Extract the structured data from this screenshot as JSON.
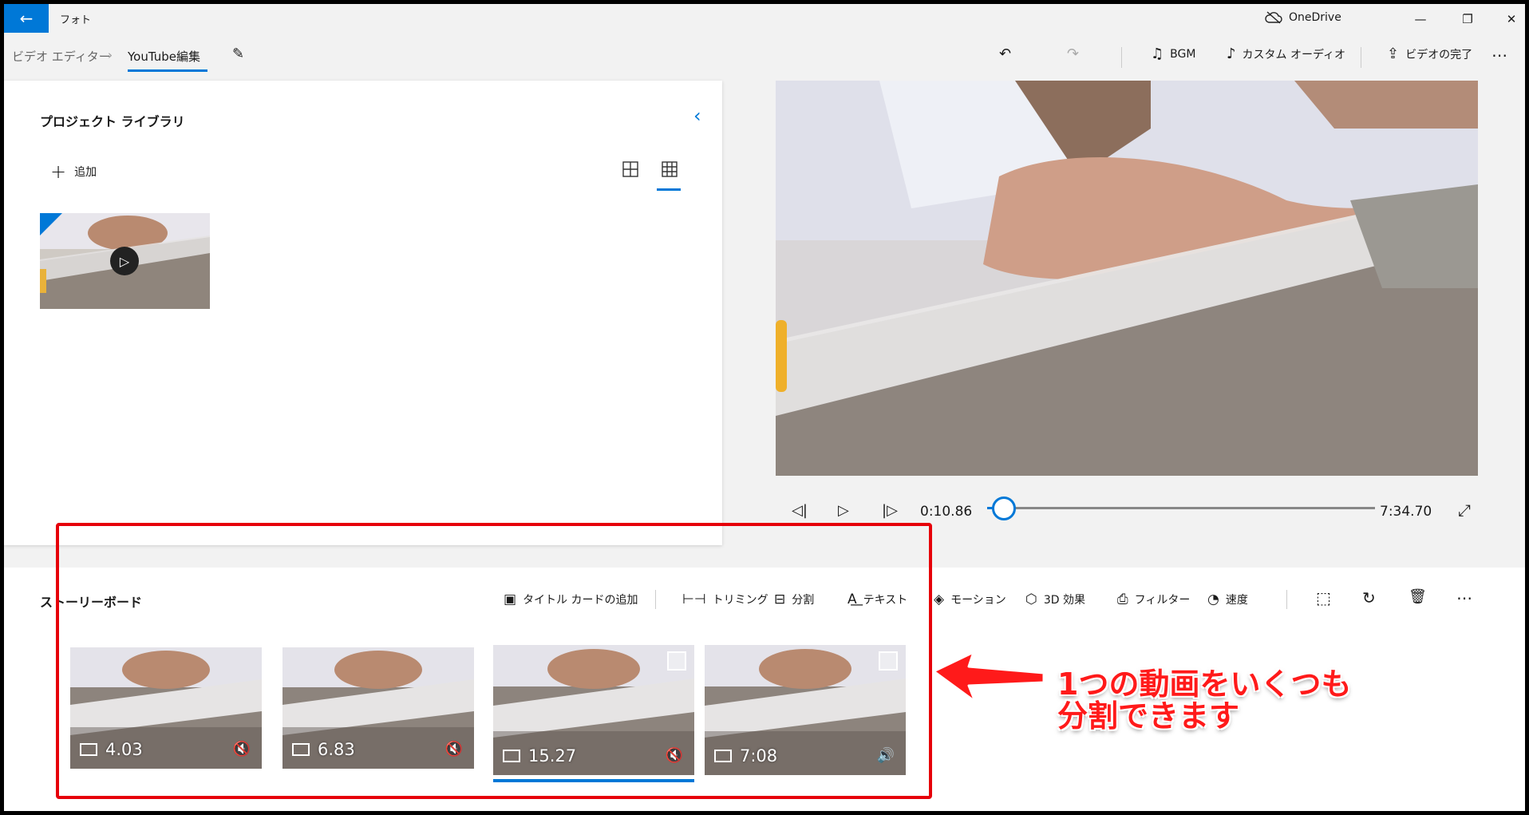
{
  "titlebar": {
    "back_icon": "←",
    "app_title": "フォト",
    "onedrive_label": "OneDrive",
    "minimize_icon": "—",
    "restore_icon": "❐",
    "close_icon": "✕"
  },
  "cmdbar": {
    "breadcrumb_root": "ビデオ エディター",
    "breadcrumb_sep": "›",
    "breadcrumb_current": "YouTube編集",
    "pencil_icon": "✎",
    "undo_icon": "↶",
    "redo_icon": "↷",
    "bgm_icon": "♫",
    "bgm_label": "BGM",
    "custom_audio_icon": "♪",
    "custom_audio_label": "カスタム オーディオ",
    "finish_icon": "⇪",
    "finish_label": "ビデオの完了",
    "more_icon": "⋯"
  },
  "library": {
    "title": "プロジェクト ライブラリ",
    "collapse_icon": "‹",
    "add_icon": "+",
    "add_label": "追加",
    "play_icon": "▷"
  },
  "player": {
    "prev_frame_icon": "◁|",
    "play_icon": "▷",
    "next_frame_icon": "|▷",
    "current_time": "0:10.86",
    "total_time": "7:34.70",
    "fullscreen_icon": "⤢",
    "progress": 0.024
  },
  "storyboard": {
    "title": "ストーリーボード",
    "title_card_icon": "▣",
    "title_card_label": "タイトル カードの追加",
    "trim_icon": "⊢⊣",
    "trim_label": "トリミング",
    "split_icon": "⊟",
    "split_label": "分割",
    "text_icon": "A͟",
    "text_label": "テキスト",
    "motion_icon": "◈",
    "motion_label": "モーション",
    "effects_icon": "⬡",
    "effects_label": "3D 効果",
    "filter_icon": "⎙",
    "filter_label": "フィルター",
    "speed_icon": "◔",
    "speed_label": "速度",
    "resize_icon": "⬚",
    "rotate_icon": "↻",
    "delete_icon": "🗑",
    "more_icon": "⋯",
    "clips": [
      {
        "duration": "4.03",
        "audio_icon": "🔇"
      },
      {
        "duration": "6.83",
        "audio_icon": "🔇"
      },
      {
        "duration": "15.27",
        "audio_icon": "🔇"
      },
      {
        "duration": "7:08",
        "audio_icon": "🔊"
      }
    ]
  },
  "annotation": {
    "line1": "1つの動画をいくつも",
    "line2": "分割できます",
    "color": "#ff1a1a"
  }
}
